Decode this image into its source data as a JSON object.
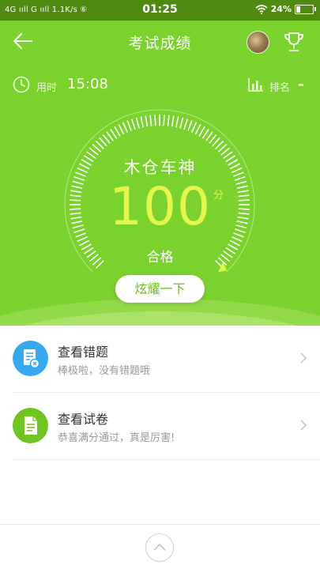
{
  "status_bar": {
    "network": "4G ııll G ııll 1.1K/s ⑥",
    "time": "01:25",
    "battery_text": "24%",
    "battery_level": 0.24
  },
  "header": {
    "title": "考试成绩"
  },
  "stats": {
    "time_label": "用时",
    "time_value": "15:08",
    "rank_label": "排名",
    "rank_value": "–"
  },
  "result": {
    "name": "木仓车神",
    "score": "100",
    "score_unit": "分",
    "status": "合格",
    "share_label": "炫耀一下",
    "progress": 1.0
  },
  "list": [
    {
      "title": "查看错题",
      "subtitle": "棒极啦，没有错题哦",
      "icon": "wrong-questions-icon",
      "icon_color": "#38a8f0"
    },
    {
      "title": "查看试卷",
      "subtitle": "恭喜满分通过，真是厉害!",
      "icon": "exam-paper-icon",
      "icon_color": "#6fc41f"
    }
  ],
  "colors": {
    "accent_green": "#7ad22c",
    "score_yellow": "#e5f74a"
  }
}
